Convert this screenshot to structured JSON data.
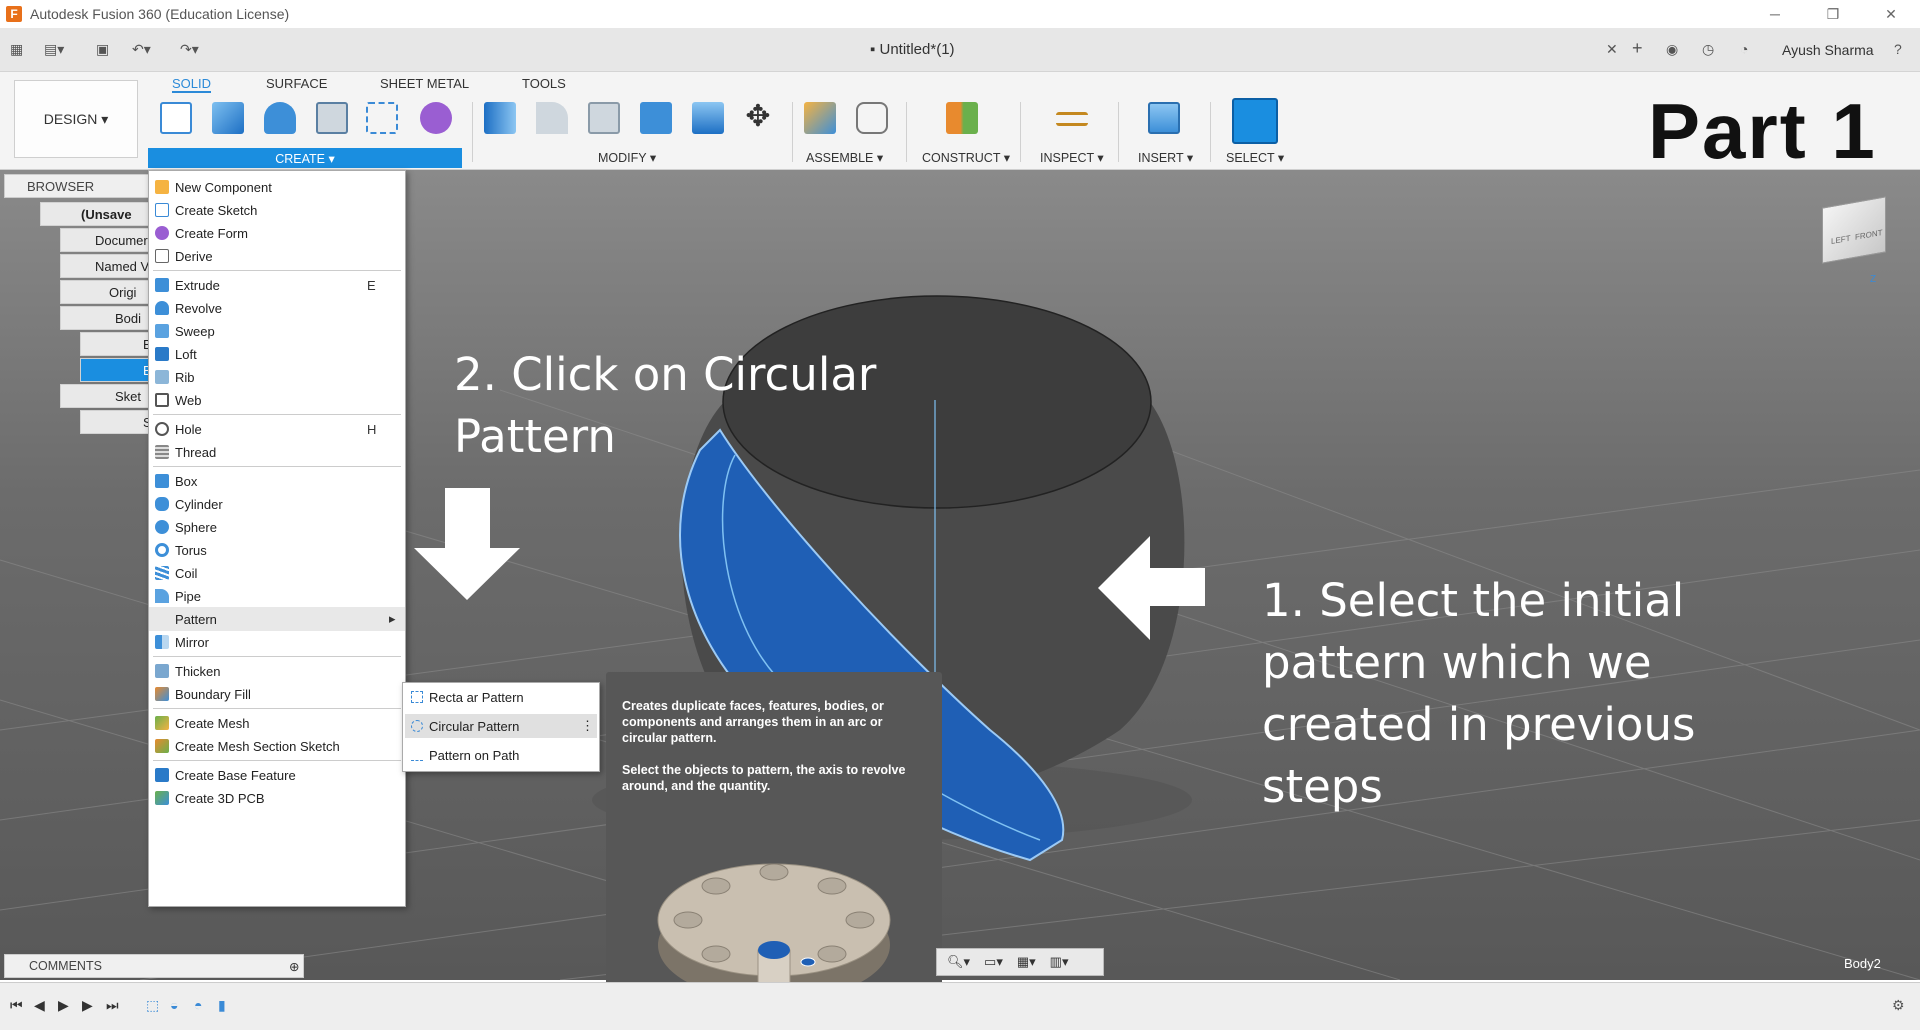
{
  "window": {
    "title": "Autodesk Fusion 360 (Education License)",
    "doc_tab": "Untitled*(1)",
    "user": "Ayush Sharma",
    "minimize": "─",
    "restore": "❐",
    "close": "✕"
  },
  "ribbon": {
    "workspace": "DESIGN ▾",
    "tabs": [
      "SOLID",
      "SURFACE",
      "SHEET METAL",
      "TOOLS"
    ],
    "groups": [
      "CREATE ▾",
      "MODIFY ▾",
      "ASSEMBLE ▾",
      "CONSTRUCT ▾",
      "INSPECT ▾",
      "INSERT ▾",
      "SELECT ▾"
    ]
  },
  "browser": {
    "title": "BROWSER",
    "rows": [
      "(Unsave",
      "Documer",
      "Named V",
      "Origi",
      "Bodi",
      "B",
      "B",
      "Sket",
      "S"
    ]
  },
  "create_menu": {
    "items": [
      {
        "label": "New Component",
        "key": ""
      },
      {
        "label": "Create Sketch",
        "key": ""
      },
      {
        "label": "Create Form",
        "key": ""
      },
      {
        "label": "Derive",
        "key": ""
      },
      {
        "label": "Extrude",
        "key": "E"
      },
      {
        "label": "Revolve",
        "key": ""
      },
      {
        "label": "Sweep",
        "key": ""
      },
      {
        "label": "Loft",
        "key": ""
      },
      {
        "label": "Rib",
        "key": ""
      },
      {
        "label": "Web",
        "key": ""
      },
      {
        "label": "Hole",
        "key": "H"
      },
      {
        "label": "Thread",
        "key": ""
      },
      {
        "label": "Box",
        "key": ""
      },
      {
        "label": "Cylinder",
        "key": ""
      },
      {
        "label": "Sphere",
        "key": ""
      },
      {
        "label": "Torus",
        "key": ""
      },
      {
        "label": "Coil",
        "key": ""
      },
      {
        "label": "Pipe",
        "key": ""
      },
      {
        "label": "Pattern",
        "key": "▸"
      },
      {
        "label": "Mirror",
        "key": ""
      },
      {
        "label": "Thicken",
        "key": ""
      },
      {
        "label": "Boundary Fill",
        "key": ""
      },
      {
        "label": "Create Mesh",
        "key": ""
      },
      {
        "label": "Create Mesh Section Sketch",
        "key": ""
      },
      {
        "label": "Create Base Feature",
        "key": ""
      },
      {
        "label": "Create 3D PCB",
        "key": ""
      }
    ]
  },
  "pattern_submenu": {
    "items": [
      "Recta    ar Pattern",
      "Circular Pattern",
      "Pattern on Path"
    ]
  },
  "tooltip": {
    "line1": "Creates duplicate faces, features, bodies, or components and arranges them in an arc or circular pattern.",
    "line2": "Select the objects to pattern, the axis to revolve around, and the quantity."
  },
  "annotations": {
    "part": "Part 1",
    "step2_line1": "2. Click on Circular",
    "step2_line2": "Pattern",
    "step1_line1": "1. Select the initial",
    "step1_line2": "pattern which we",
    "step1_line3": "created in previous",
    "step1_line4": "steps"
  },
  "viewcube": {
    "left": "LEFT",
    "front": "FRONT",
    "z": "Z"
  },
  "comments": {
    "label": "COMMENTS"
  },
  "status": {
    "body_label": "Body2"
  },
  "colors": {
    "accent": "#1a8ee0",
    "highlight_blue": "#1f5fb5",
    "body_dark": "#3d3d3d"
  }
}
